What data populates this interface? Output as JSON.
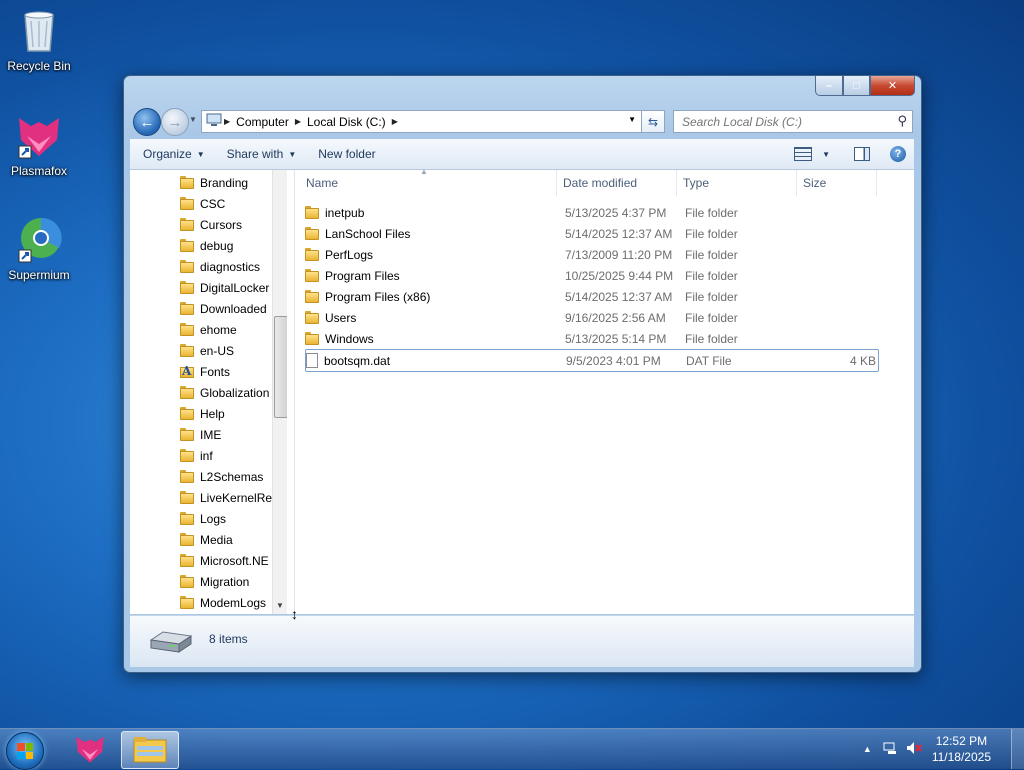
{
  "desktop": {
    "icons": [
      {
        "label": "Recycle Bin",
        "icon": "recycle-bin-icon"
      },
      {
        "label": "Plasmafox",
        "icon": "plasmafox-icon"
      },
      {
        "label": "Supermium",
        "icon": "supermium-icon"
      }
    ]
  },
  "window": {
    "caption_buttons": {
      "minimize": "–",
      "maximize": "□",
      "close": "✕"
    },
    "address": {
      "crumbs": [
        "Computer",
        "Local Disk (C:)"
      ],
      "search_placeholder": "Search Local Disk (C:)"
    },
    "toolbar": {
      "organize": "Organize",
      "share_with": "Share with",
      "new_folder": "New folder"
    },
    "nav_pane": {
      "items": [
        {
          "label": "Branding",
          "icon": "folder-icon"
        },
        {
          "label": "CSC",
          "icon": "folder-icon"
        },
        {
          "label": "Cursors",
          "icon": "folder-icon"
        },
        {
          "label": "debug",
          "icon": "folder-icon"
        },
        {
          "label": "diagnostics",
          "icon": "folder-icon"
        },
        {
          "label": "DigitalLocker",
          "icon": "folder-icon"
        },
        {
          "label": "Downloaded",
          "icon": "folder-icon"
        },
        {
          "label": "ehome",
          "icon": "folder-icon"
        },
        {
          "label": "en-US",
          "icon": "folder-icon"
        },
        {
          "label": "Fonts",
          "icon": "fonts-folder-icon"
        },
        {
          "label": "Globalization",
          "icon": "folder-icon"
        },
        {
          "label": "Help",
          "icon": "folder-icon"
        },
        {
          "label": "IME",
          "icon": "folder-icon"
        },
        {
          "label": "inf",
          "icon": "folder-icon"
        },
        {
          "label": "L2Schemas",
          "icon": "folder-icon"
        },
        {
          "label": "LiveKernelRep",
          "icon": "folder-icon"
        },
        {
          "label": "Logs",
          "icon": "folder-icon"
        },
        {
          "label": "Media",
          "icon": "folder-icon"
        },
        {
          "label": "Microsoft.NE",
          "icon": "folder-icon"
        },
        {
          "label": "Migration",
          "icon": "folder-icon"
        },
        {
          "label": "ModemLogs",
          "icon": "folder-icon"
        }
      ]
    },
    "file_list": {
      "columns": {
        "name": "Name",
        "date": "Date modified",
        "type": "Type",
        "size": "Size"
      },
      "rows": [
        {
          "name": "inetpub",
          "date": "5/13/2025 4:37 PM",
          "type": "File folder",
          "size": "",
          "icon": "folder-icon"
        },
        {
          "name": "LanSchool Files",
          "date": "5/14/2025 12:37 AM",
          "type": "File folder",
          "size": "",
          "icon": "folder-icon"
        },
        {
          "name": "PerfLogs",
          "date": "7/13/2009 11:20 PM",
          "type": "File folder",
          "size": "",
          "icon": "folder-icon"
        },
        {
          "name": "Program Files",
          "date": "10/25/2025 9:44 PM",
          "type": "File folder",
          "size": "",
          "icon": "folder-icon"
        },
        {
          "name": "Program Files (x86)",
          "date": "5/14/2025 12:37 AM",
          "type": "File folder",
          "size": "",
          "icon": "folder-icon"
        },
        {
          "name": "Users",
          "date": "9/16/2025 2:56 AM",
          "type": "File folder",
          "size": "",
          "icon": "folder-icon"
        },
        {
          "name": "Windows",
          "date": "5/13/2025 5:14 PM",
          "type": "File folder",
          "size": "",
          "icon": "folder-icon"
        },
        {
          "name": "bootsqm.dat",
          "date": "9/5/2023 4:01 PM",
          "type": "DAT File",
          "size": "4 KB",
          "icon": "file-icon"
        }
      ]
    },
    "details": {
      "count": "8 items"
    }
  },
  "taskbar": {
    "clock_time": "12:52 PM",
    "clock_date": "11/18/2025"
  }
}
